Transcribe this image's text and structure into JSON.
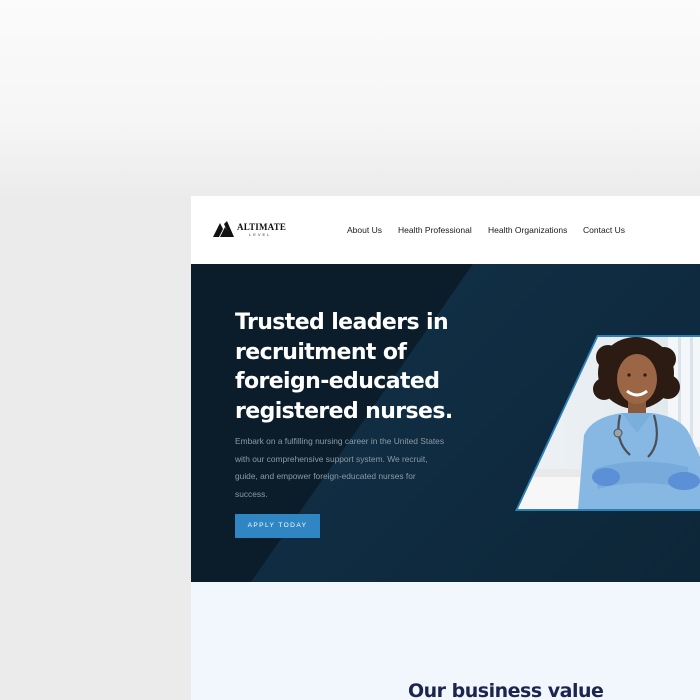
{
  "brand": {
    "name": "ALTIMATE",
    "tagline": "LEVEL"
  },
  "nav": {
    "items": [
      {
        "label": "About Us"
      },
      {
        "label": "Health Professional"
      },
      {
        "label": "Health Organizations"
      },
      {
        "label": "Contact Us"
      }
    ]
  },
  "hero": {
    "title": "Trusted leaders in\nrecruitment of\nforeign-educated\nregistered nurses.",
    "description": "Embark on a fulfilling nursing career in the United States\nwith our comprehensive support system. We recruit,\nguide, and empower foreign-educated nurses for\nsuccess.",
    "cta_label": "APPLY TODAY",
    "image_label": "nurse-photo"
  },
  "values": {
    "title": "Our business value"
  },
  "colors": {
    "accent": "#2f86c2",
    "hero_dark": "#0b1d2b",
    "hero_light": "#12324a",
    "section_bg": "#f1f7fd",
    "section_title": "#1c2450"
  }
}
